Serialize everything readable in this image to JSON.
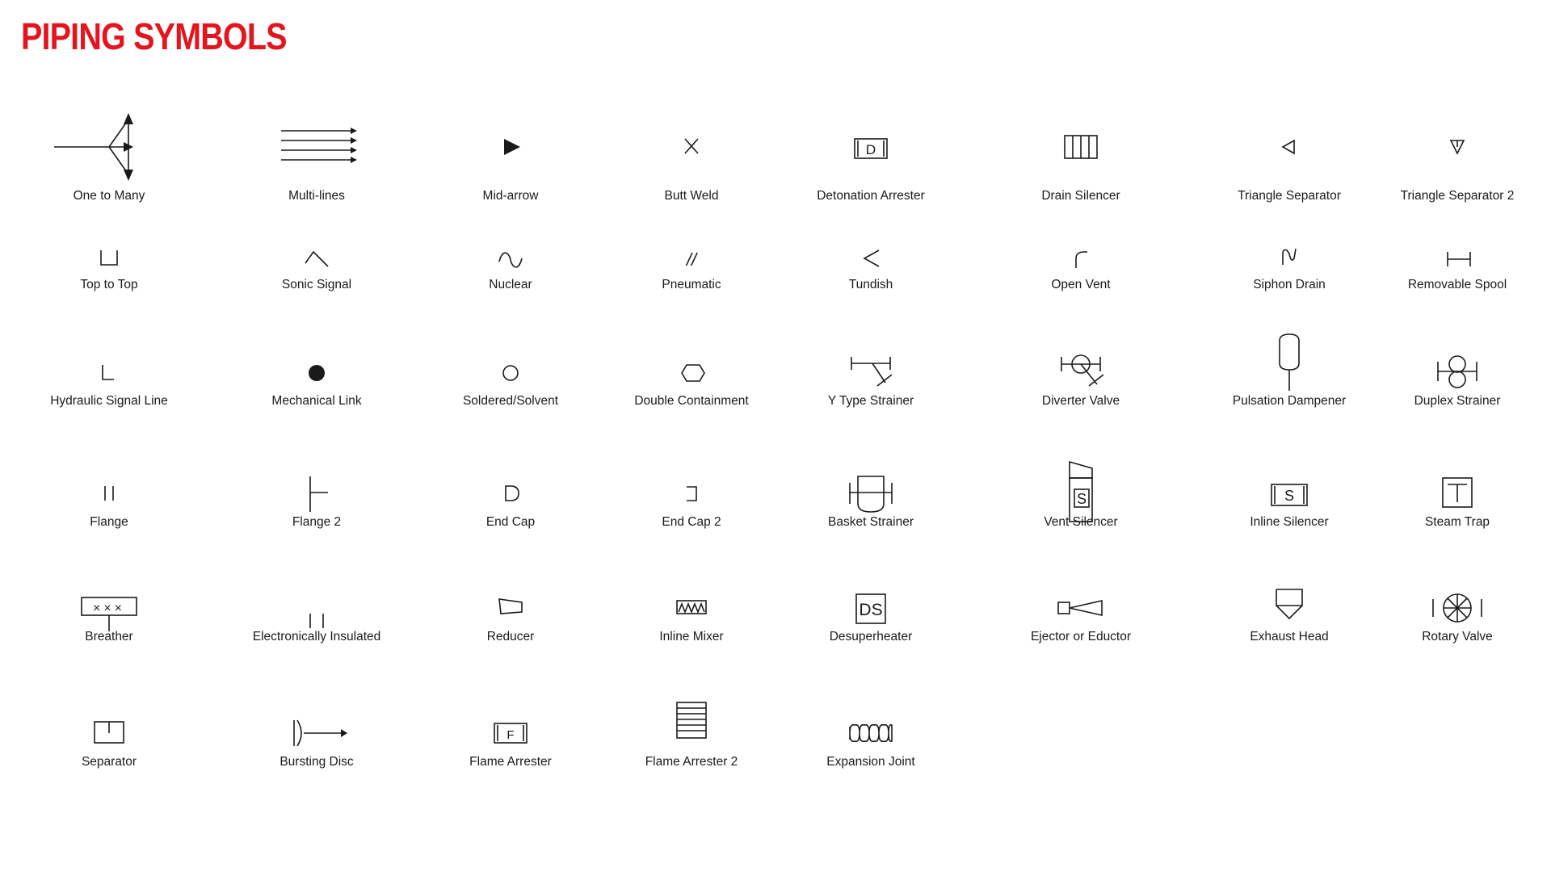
{
  "header": {
    "title": "PIPING SYMBOLS",
    "title_color": "#e3161f"
  },
  "symbols": [
    {
      "id": "one-to-many",
      "label": "One to Many"
    },
    {
      "id": "multi-lines",
      "label": "Multi-lines"
    },
    {
      "id": "mid-arrow",
      "label": "Mid-arrow"
    },
    {
      "id": "butt-weld",
      "label": "Butt Weld"
    },
    {
      "id": "detonation-arrester",
      "label": "Detonation Arrester",
      "glyph": "D"
    },
    {
      "id": "drain-silencer",
      "label": "Drain Silencer"
    },
    {
      "id": "triangle-separator",
      "label": "Triangle Separator"
    },
    {
      "id": "triangle-separator-2",
      "label": "Triangle Separator 2"
    },
    {
      "id": "top-to-top",
      "label": "Top to Top"
    },
    {
      "id": "sonic-signal",
      "label": "Sonic Signal"
    },
    {
      "id": "nuclear",
      "label": "Nuclear"
    },
    {
      "id": "pneumatic",
      "label": "Pneumatic",
      "glyph": "//"
    },
    {
      "id": "tundish",
      "label": "Tundish"
    },
    {
      "id": "open-vent",
      "label": "Open Vent"
    },
    {
      "id": "siphon-drain",
      "label": "Siphon Drain"
    },
    {
      "id": "removable-spool",
      "label": "Removable Spool"
    },
    {
      "id": "hydraulic-signal-line",
      "label": "Hydraulic Signal Line"
    },
    {
      "id": "mechanical-link",
      "label": "Mechanical Link"
    },
    {
      "id": "soldered-solvent",
      "label": "Soldered/Solvent"
    },
    {
      "id": "double-containment",
      "label": "Double Containment"
    },
    {
      "id": "y-type-strainer",
      "label": "Y Type Strainer"
    },
    {
      "id": "diverter-valve",
      "label": "Diverter Valve"
    },
    {
      "id": "pulsation-dampener",
      "label": "Pulsation Dampener"
    },
    {
      "id": "duplex-strainer",
      "label": "Duplex Strainer"
    },
    {
      "id": "flange",
      "label": "Flange"
    },
    {
      "id": "flange-2",
      "label": "Flange 2"
    },
    {
      "id": "end-cap",
      "label": "End Cap"
    },
    {
      "id": "end-cap-2",
      "label": "End Cap 2"
    },
    {
      "id": "basket-strainer",
      "label": "Basket Strainer"
    },
    {
      "id": "vent-silencer",
      "label": "Vent Silencer",
      "glyph": "S"
    },
    {
      "id": "inline-silencer",
      "label": "Inline Silencer",
      "glyph": "S"
    },
    {
      "id": "steam-trap",
      "label": "Steam Trap"
    },
    {
      "id": "breather",
      "label": "Breather"
    },
    {
      "id": "electronically-insulated",
      "label": "Electronically Insulated"
    },
    {
      "id": "reducer",
      "label": "Reducer"
    },
    {
      "id": "inline-mixer",
      "label": "Inline Mixer"
    },
    {
      "id": "desuperheater",
      "label": "Desuperheater",
      "glyph": "DS"
    },
    {
      "id": "ejector-or-eductor",
      "label": "Ejector or Eductor"
    },
    {
      "id": "exhaust-head",
      "label": "Exhaust Head"
    },
    {
      "id": "rotary-valve",
      "label": "Rotary Valve"
    },
    {
      "id": "separator",
      "label": "Separator"
    },
    {
      "id": "bursting-disc",
      "label": "Bursting Disc"
    },
    {
      "id": "flame-arrester",
      "label": "Flame Arrester",
      "glyph": "F"
    },
    {
      "id": "flame-arrester-2",
      "label": "Flame Arrester 2"
    },
    {
      "id": "expansion-joint",
      "label": "Expansion Joint"
    }
  ]
}
